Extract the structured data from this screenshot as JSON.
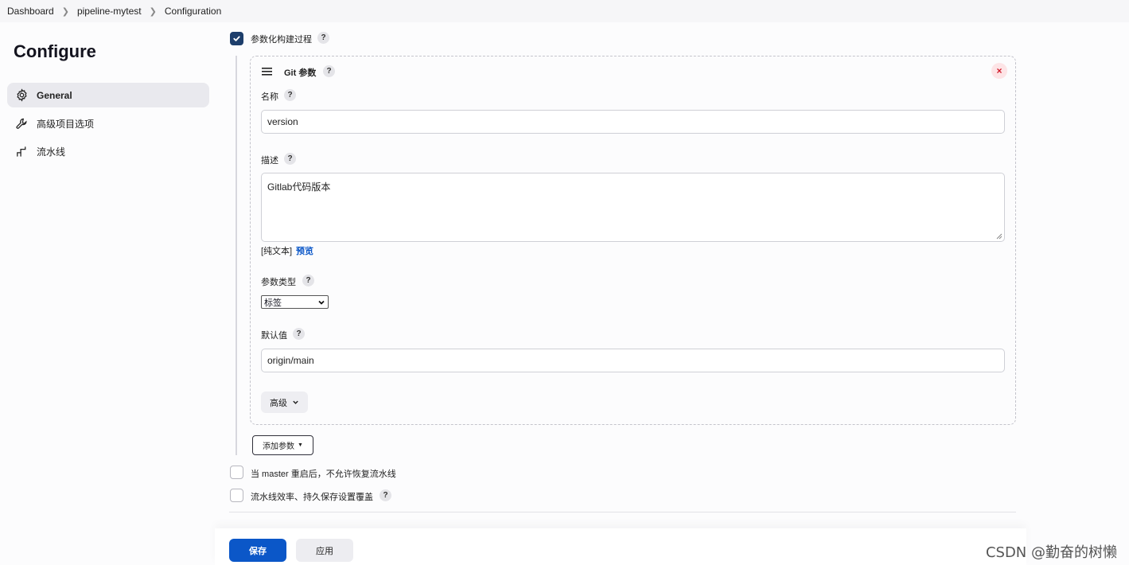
{
  "breadcrumb": {
    "items": [
      "Dashboard",
      "pipeline-mytest",
      "Configuration"
    ]
  },
  "page": {
    "title": "Configure"
  },
  "sidebar": {
    "items": [
      {
        "label": "General",
        "icon": "gear-icon",
        "active": true
      },
      {
        "label": "高级项目选项",
        "icon": "wrench-icon",
        "active": false
      },
      {
        "label": "流水线",
        "icon": "pipeline-icon",
        "active": false
      }
    ]
  },
  "form": {
    "parameterized": {
      "label": "参数化构建过程",
      "checked": true
    },
    "git_param": {
      "title": "Git 参数",
      "name_label": "名称",
      "name_value": "version",
      "desc_label": "描述",
      "desc_value": "Gitlab代码版本",
      "plain_text": "[纯文本]",
      "preview": "预览",
      "type_label": "参数类型",
      "type_value": "标签",
      "default_label": "默认值",
      "default_value": "origin/main",
      "advanced": "高级"
    },
    "add_param": "添加参数",
    "no_resume": {
      "label": "当 master 重启后，不允许恢复流水线",
      "checked": false
    },
    "durability": {
      "label": "流水线效率、持久保存设置覆盖",
      "checked": false
    }
  },
  "actions": {
    "save": "保存",
    "apply": "应用"
  },
  "help_glyph": "?",
  "close_glyph": "×",
  "watermark": "CSDN @勤奋的树懒",
  "colors": {
    "primary": "#0b57c8",
    "checkbox": "#1d3e6b",
    "danger": "#d11a2a"
  }
}
